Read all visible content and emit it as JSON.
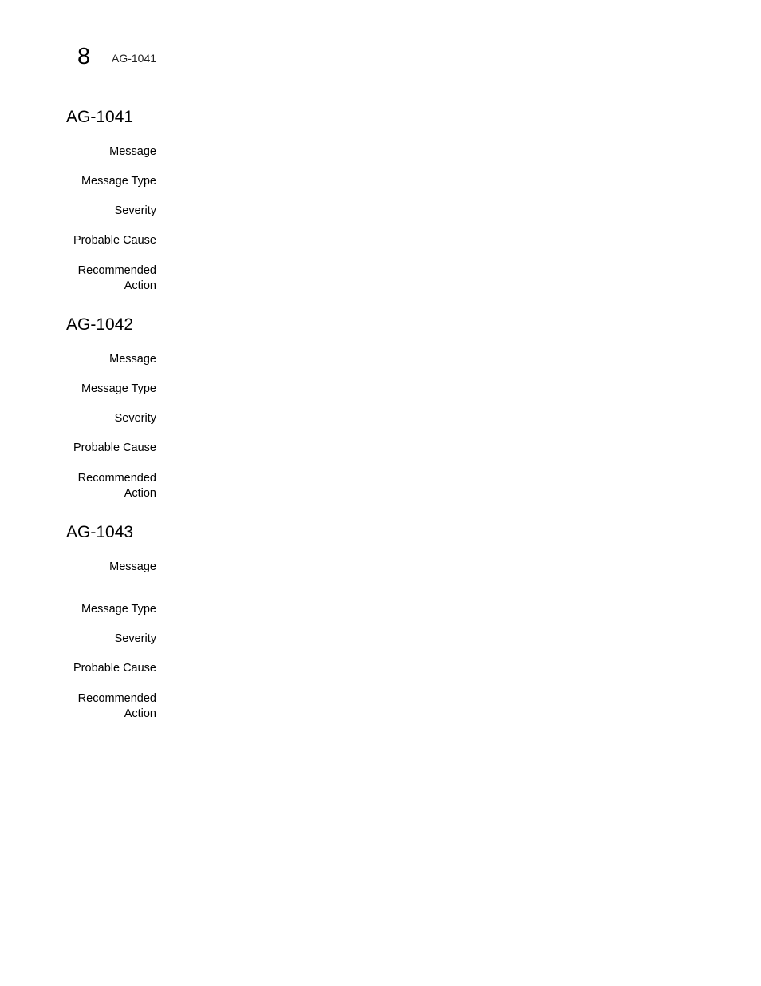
{
  "header": {
    "chapter_number": "8",
    "running_title": "AG-1041"
  },
  "sections": [
    {
      "title": "AG-1041",
      "fields": [
        "Message",
        "Message Type",
        "Severity",
        "Probable Cause",
        "Recommended\nAction"
      ]
    },
    {
      "title": "AG-1042",
      "fields": [
        "Message",
        "Message Type",
        "Severity",
        "Probable Cause",
        "Recommended\nAction"
      ]
    },
    {
      "title": "AG-1043",
      "fields": [
        "Message",
        "Message Type",
        "Severity",
        "Probable Cause",
        "Recommended\nAction"
      ]
    }
  ]
}
